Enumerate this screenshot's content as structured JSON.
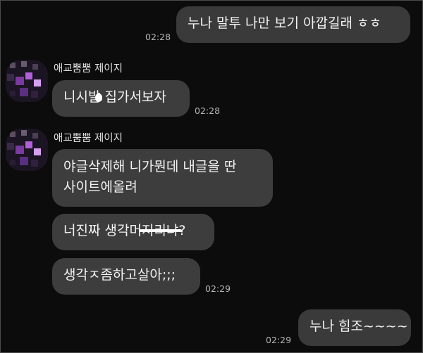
{
  "messages": {
    "m1": {
      "text": "누나 말투 나만 보기 아깝길래 ㅎㅎ",
      "time": "02:28"
    },
    "m2": {
      "sender": "애교뿜뿜 제이지",
      "text": "니시발 집가서보자",
      "time": "02:28"
    },
    "m3": {
      "sender": "애교뿜뿜 제이지",
      "line1": "야글삭제해 니가뭔데 내글을 딴",
      "line2": "사이트에올려"
    },
    "m4": {
      "text": "너진짜 생각머지리냐?"
    },
    "m5": {
      "text": "생각ㅈ좀하고살아;;;",
      "time": "02:29"
    },
    "m6": {
      "text": "누나 힘조~~~~",
      "time": "02:29"
    }
  },
  "colors": {
    "background": "#0c0c0c",
    "bubble": "#3d3d3d",
    "text": "#f3f3f3",
    "time": "#b5b5b5"
  }
}
